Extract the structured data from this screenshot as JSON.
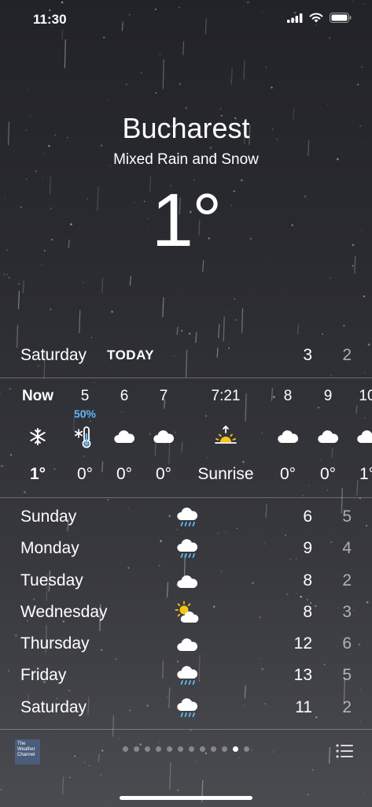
{
  "status_bar": {
    "time": "11:30"
  },
  "location": {
    "city": "Bucharest",
    "condition": "Mixed Rain and Snow",
    "temperature": "1°"
  },
  "today": {
    "day": "Saturday",
    "tag": "TODAY",
    "high": "3",
    "low": "2"
  },
  "hourly": [
    {
      "time": "Now",
      "precip": "",
      "icon": "snowflake-icon",
      "temp": "1°"
    },
    {
      "time": "5",
      "precip": "50%",
      "icon": "cold-thermometer-icon",
      "temp": "0°"
    },
    {
      "time": "6",
      "precip": "",
      "icon": "cloud-icon",
      "temp": "0°"
    },
    {
      "time": "7",
      "precip": "",
      "icon": "cloud-icon",
      "temp": "0°"
    },
    {
      "time": "7:21",
      "precip": "",
      "icon": "sunrise-icon",
      "temp": "Sunrise"
    },
    {
      "time": "8",
      "precip": "",
      "icon": "cloud-icon",
      "temp": "0°"
    },
    {
      "time": "9",
      "precip": "",
      "icon": "cloud-icon",
      "temp": "0°"
    },
    {
      "time": "10",
      "precip": "",
      "icon": "cloud-icon",
      "temp": "1°"
    }
  ],
  "daily": [
    {
      "day": "Sunday",
      "icon": "rain-cloud-icon",
      "high": "6",
      "low": "5"
    },
    {
      "day": "Monday",
      "icon": "rain-cloud-icon",
      "high": "9",
      "low": "4"
    },
    {
      "day": "Tuesday",
      "icon": "cloud-icon",
      "high": "8",
      "low": "2"
    },
    {
      "day": "Wednesday",
      "icon": "partly-sunny-icon",
      "high": "8",
      "low": "3"
    },
    {
      "day": "Thursday",
      "icon": "cloud-icon",
      "high": "12",
      "low": "6"
    },
    {
      "day": "Friday",
      "icon": "rain-cloud-icon",
      "high": "13",
      "low": "5"
    },
    {
      "day": "Saturday",
      "icon": "rain-cloud-icon",
      "high": "11",
      "low": "2"
    }
  ],
  "footer": {
    "logo_text": "The Weather Channel",
    "page_count": 12,
    "active_page": 10
  },
  "colors": {
    "precip": "#64b5f6",
    "sun": "#f5c518"
  }
}
